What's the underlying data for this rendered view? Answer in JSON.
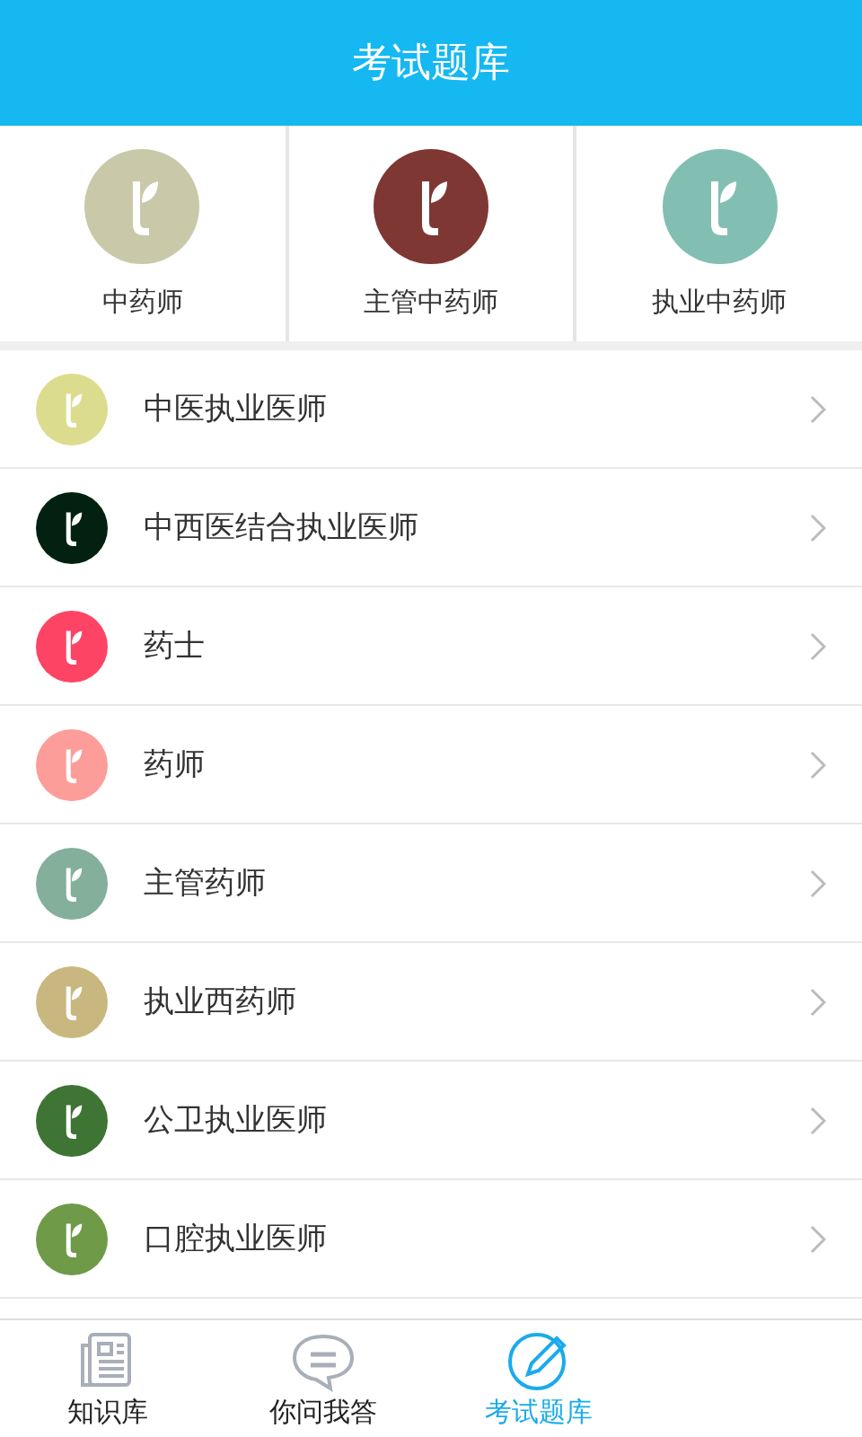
{
  "header": {
    "title": "考试题库"
  },
  "categories": [
    {
      "label": "中药师",
      "color": "#c9c9a9"
    },
    {
      "label": "主管中药师",
      "color": "#7f3734"
    },
    {
      "label": "执业中药师",
      "color": "#82bfb2"
    }
  ],
  "list": [
    {
      "label": "中医执业医师",
      "color": "#dcdc8e"
    },
    {
      "label": "中西医结合执业医师",
      "color": "#032110"
    },
    {
      "label": "药士",
      "color": "#fd4465"
    },
    {
      "label": "药师",
      "color": "#fc9d9a"
    },
    {
      "label": "主管药师",
      "color": "#83af9b"
    },
    {
      "label": "执业西药师",
      "color": "#c8b880"
    },
    {
      "label": "公卫执业医师",
      "color": "#3e7434"
    },
    {
      "label": "口腔执业医师",
      "color": "#6f9a48"
    }
  ],
  "tabs": [
    {
      "label": "知识库",
      "kind": "news",
      "selected": false
    },
    {
      "label": "你问我答",
      "kind": "chat",
      "selected": false
    },
    {
      "label": "考试题库",
      "kind": "pen",
      "selected": true
    }
  ]
}
